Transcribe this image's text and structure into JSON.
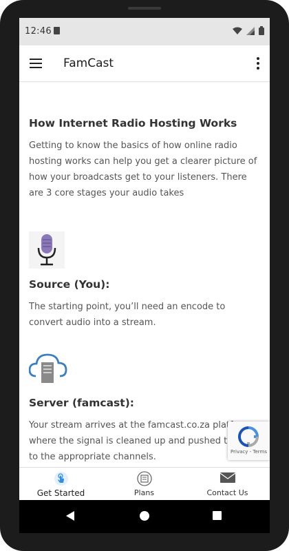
{
  "status_bar": {
    "time": "12:46"
  },
  "app_bar": {
    "title": "FamCast"
  },
  "content": {
    "heading": "How Internet Radio Hosting Works",
    "intro": "Getting to know the basics of how online radio hosting works can help you get a clearer picture of how your broadcasts get to your listeners. There are 3 core stages your audio takes",
    "source": {
      "icon": "microphone-icon",
      "title": "Source (You):",
      "text": "The starting point, you’ll need an encode to convert audio into a stream."
    },
    "server": {
      "icon": "cloud-server-icon",
      "title": "Server (famcast):",
      "text": "Your stream arrives at the famcast.co.za platform where the signal is cleaned up and pushed through to the appropriate channels."
    }
  },
  "recaptcha": {
    "text": "Privacy - Terms"
  },
  "bottom_nav": {
    "items": [
      {
        "label": "Get Started",
        "icon": "touch-icon",
        "active": true
      },
      {
        "label": "Plans",
        "icon": "plans-icon",
        "active": false
      },
      {
        "label": "Contact Us",
        "icon": "mail-icon",
        "active": false
      }
    ]
  },
  "colors": {
    "mic_purple": "#8b78b8",
    "cloud_blue": "#3a7fc1",
    "active_blue": "#2f8fe6"
  }
}
